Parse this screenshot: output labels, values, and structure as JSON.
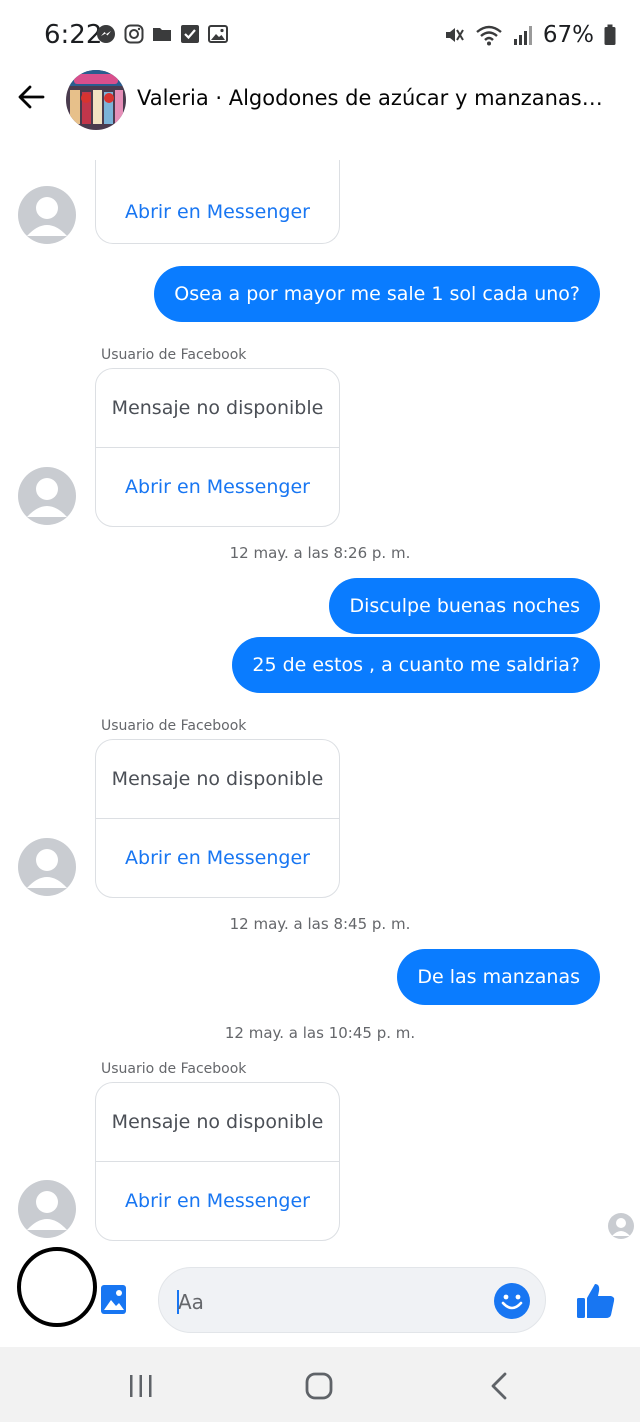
{
  "status_bar": {
    "time": "6:22",
    "battery": "67%",
    "left_icons": [
      "messenger-icon",
      "instagram-icon",
      "folder-icon",
      "checkbox-icon",
      "image-icon"
    ],
    "right_icons": [
      "mute-vibrate-icon",
      "wifi-icon",
      "signal-icon",
      "battery-icon"
    ]
  },
  "header": {
    "title": "Valeria · Algodones de azúcar y manzanas acaramel…"
  },
  "messages": {
    "card_0": {
      "link": "Abrir en Messenger"
    },
    "out_1": "Osea a por mayor me sale 1 sol cada uno?",
    "card_1": {
      "sender": "Usuario de Facebook",
      "text": "Mensaje no disponible",
      "link": "Abrir en Messenger"
    },
    "ts_1": "12 may. a las 8:26 p. m.",
    "out_2": "Disculpe buenas noches",
    "out_3": "25 de estos ,  a cuanto me saldria?",
    "card_2": {
      "sender": "Usuario de Facebook",
      "text": "Mensaje no disponible",
      "link": "Abrir en Messenger"
    },
    "ts_2": "12 may. a las 8:45 p. m.",
    "out_4": "De las manzanas",
    "ts_3": "12 may. a las 10:45 p. m.",
    "card_3": {
      "sender": "Usuario de Facebook",
      "text": "Mensaje no disponible",
      "link": "Abrir en Messenger"
    }
  },
  "composer": {
    "placeholder": "Aa"
  },
  "colors": {
    "outgoing_bubble": "#0a7cff",
    "link": "#1876f2",
    "like": "#1876f2"
  }
}
